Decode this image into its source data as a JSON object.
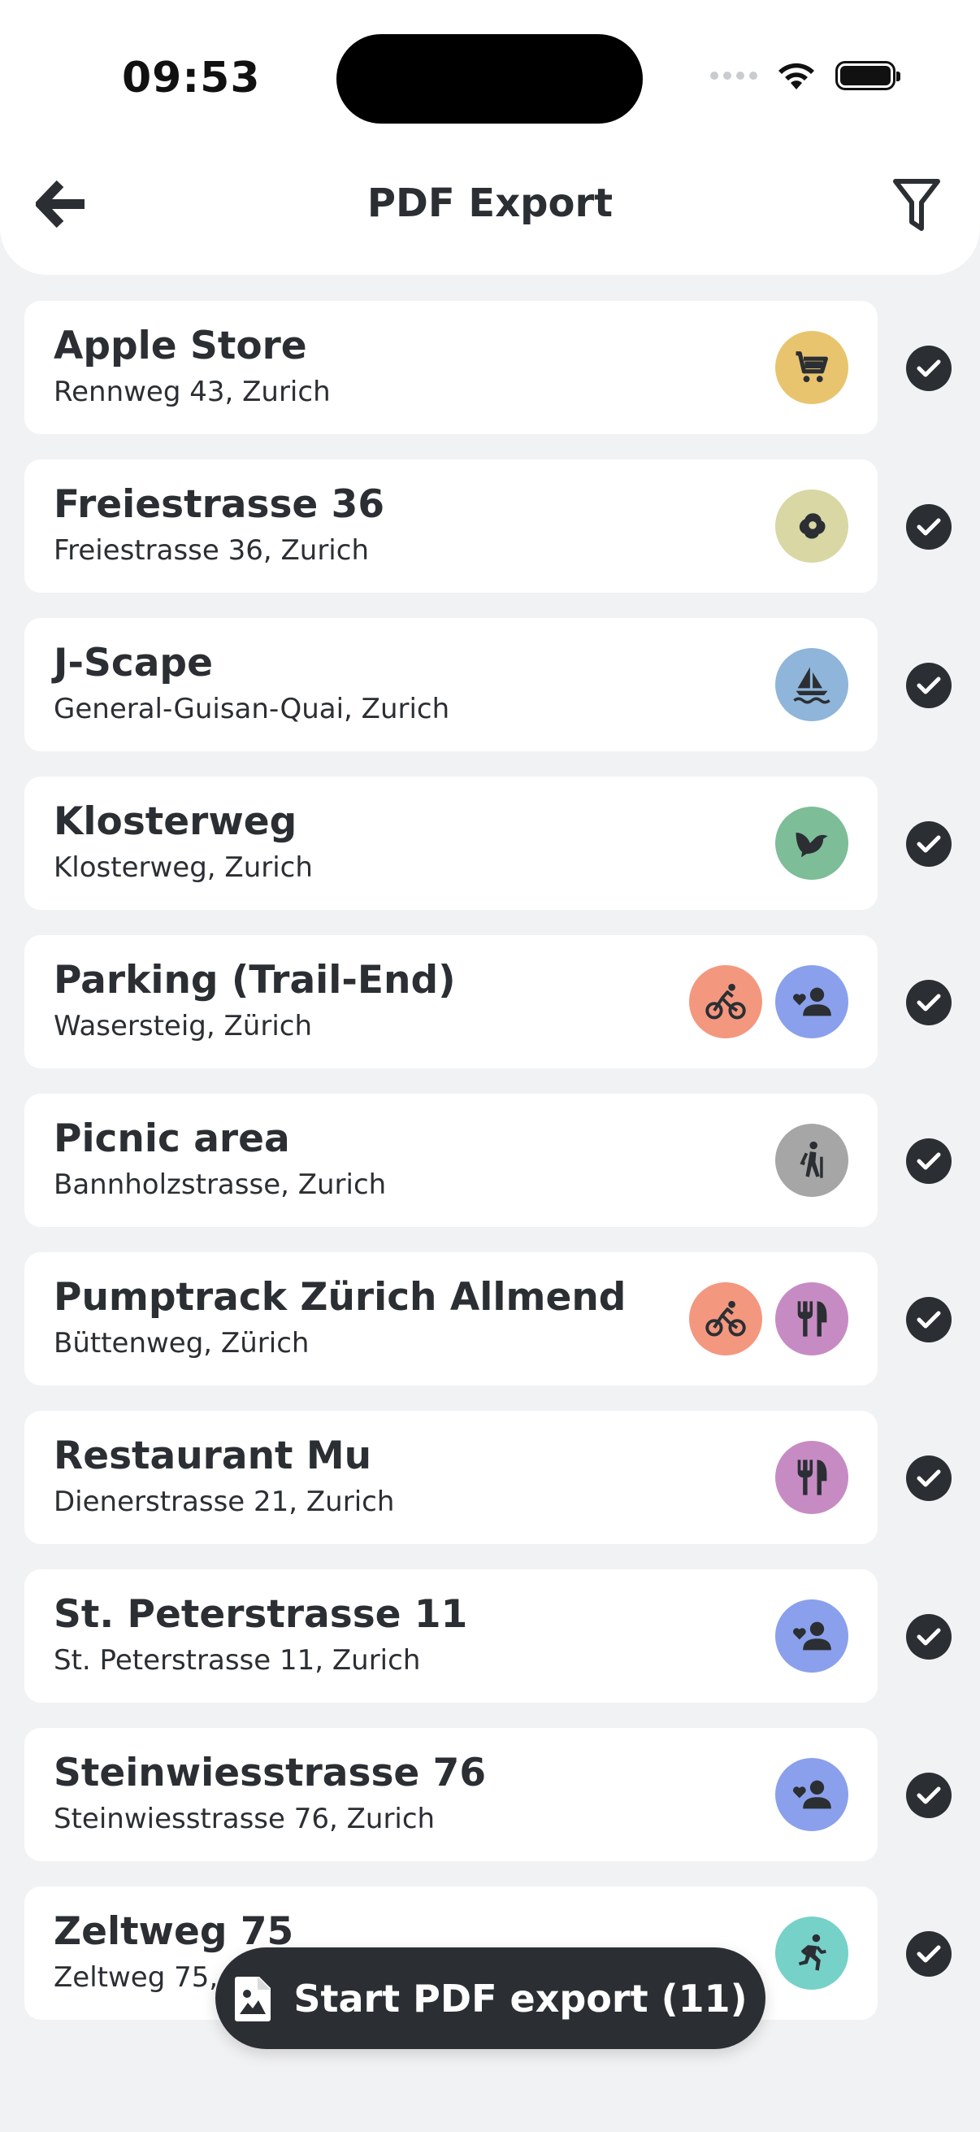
{
  "status_bar": {
    "time": "09:53"
  },
  "header": {
    "title": "PDF Export"
  },
  "colors": {
    "shopping": "#e9c46f",
    "nature": "#d9d7a4",
    "boat": "#8fb5da",
    "bird": "#7dbd98",
    "bike": "#f4977f",
    "social": "#8aa0ec",
    "hike": "#a6a6a6",
    "food": "#c78bc4",
    "run": "#76d1c8"
  },
  "places": [
    {
      "name": "Apple Store",
      "address": "Rennweg 43, Zurich",
      "icons": [
        "cart-icon"
      ],
      "selected": true
    },
    {
      "name": "Freiestrasse 36",
      "address": "Freiestrasse 36, Zurich",
      "icons": [
        "nature-icon"
      ],
      "selected": true
    },
    {
      "name": "J-Scape",
      "address": "General-Guisan-Quai, Zurich",
      "icons": [
        "sailboat-icon"
      ],
      "selected": true
    },
    {
      "name": "Klosterweg",
      "address": "Klosterweg, Zurich",
      "icons": [
        "bird-icon"
      ],
      "selected": true
    },
    {
      "name": "Parking (Trail-End)",
      "address": "Wasersteig, Zürich",
      "icons": [
        "bike-icon",
        "social-icon"
      ],
      "selected": true
    },
    {
      "name": "Picnic area",
      "address": "Bannholzstrasse, Zurich",
      "icons": [
        "hiking-icon"
      ],
      "selected": true
    },
    {
      "name": "Pumptrack Zürich Allmend",
      "address": "Büttenweg, Zürich",
      "icons": [
        "bike-icon",
        "restaurant-icon"
      ],
      "selected": true
    },
    {
      "name": "Restaurant Mu",
      "address": "Dienerstrasse 21, Zurich",
      "icons": [
        "restaurant-icon"
      ],
      "selected": true
    },
    {
      "name": "St. Peterstrasse 11",
      "address": "St. Peterstrasse 11, Zurich",
      "icons": [
        "social-icon"
      ],
      "selected": true
    },
    {
      "name": "Steinwiesstrasse 76",
      "address": "Steinwiesstrasse 76, Zurich",
      "icons": [
        "social-icon"
      ],
      "selected": true
    },
    {
      "name": "Zeltweg 75",
      "address": "Zeltweg 75, Zurich",
      "icons": [
        "running-icon"
      ],
      "selected": true
    }
  ],
  "export": {
    "label": "Start PDF export (11)"
  }
}
